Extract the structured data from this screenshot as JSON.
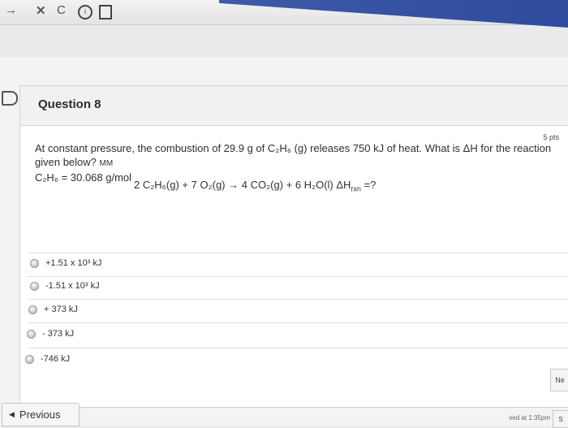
{
  "browser": {
    "back_glyph": "→",
    "close_glyph": "✕",
    "reload_glyph": "C",
    "info_glyph": "i"
  },
  "question": {
    "title": "Question 8",
    "points": "5 pts",
    "text_main": "At constant pressure, the combustion of 29.9 g of C₂H₆ (g) releases 750 kJ of heat. What is ΔH for the reaction given below?",
    "text_tail": "MM",
    "molar_mass": "C₂H₆ = 30.068 g/mol",
    "equation": "2 C₂H₆(g) + 7 O₂(g) → 4 CO₂(g) + 6 H₂O(l) ΔH",
    "equation_sub": "rxn",
    "equation_end": " =?"
  },
  "options": [
    {
      "label": "+1.51 x 10³ kJ"
    },
    {
      "label": "-1.51 x 10³ kJ"
    },
    {
      "label": "+ 373 kJ"
    },
    {
      "label": "- 373 kJ"
    },
    {
      "label": "-746 kJ"
    }
  ],
  "nav": {
    "previous": "Previous",
    "next": "Ne",
    "saved": "ved at 1:35pm",
    "submit": "S"
  },
  "colors": {
    "accent_blue": "#2e4b9e",
    "card_bg": "#ffffff"
  }
}
